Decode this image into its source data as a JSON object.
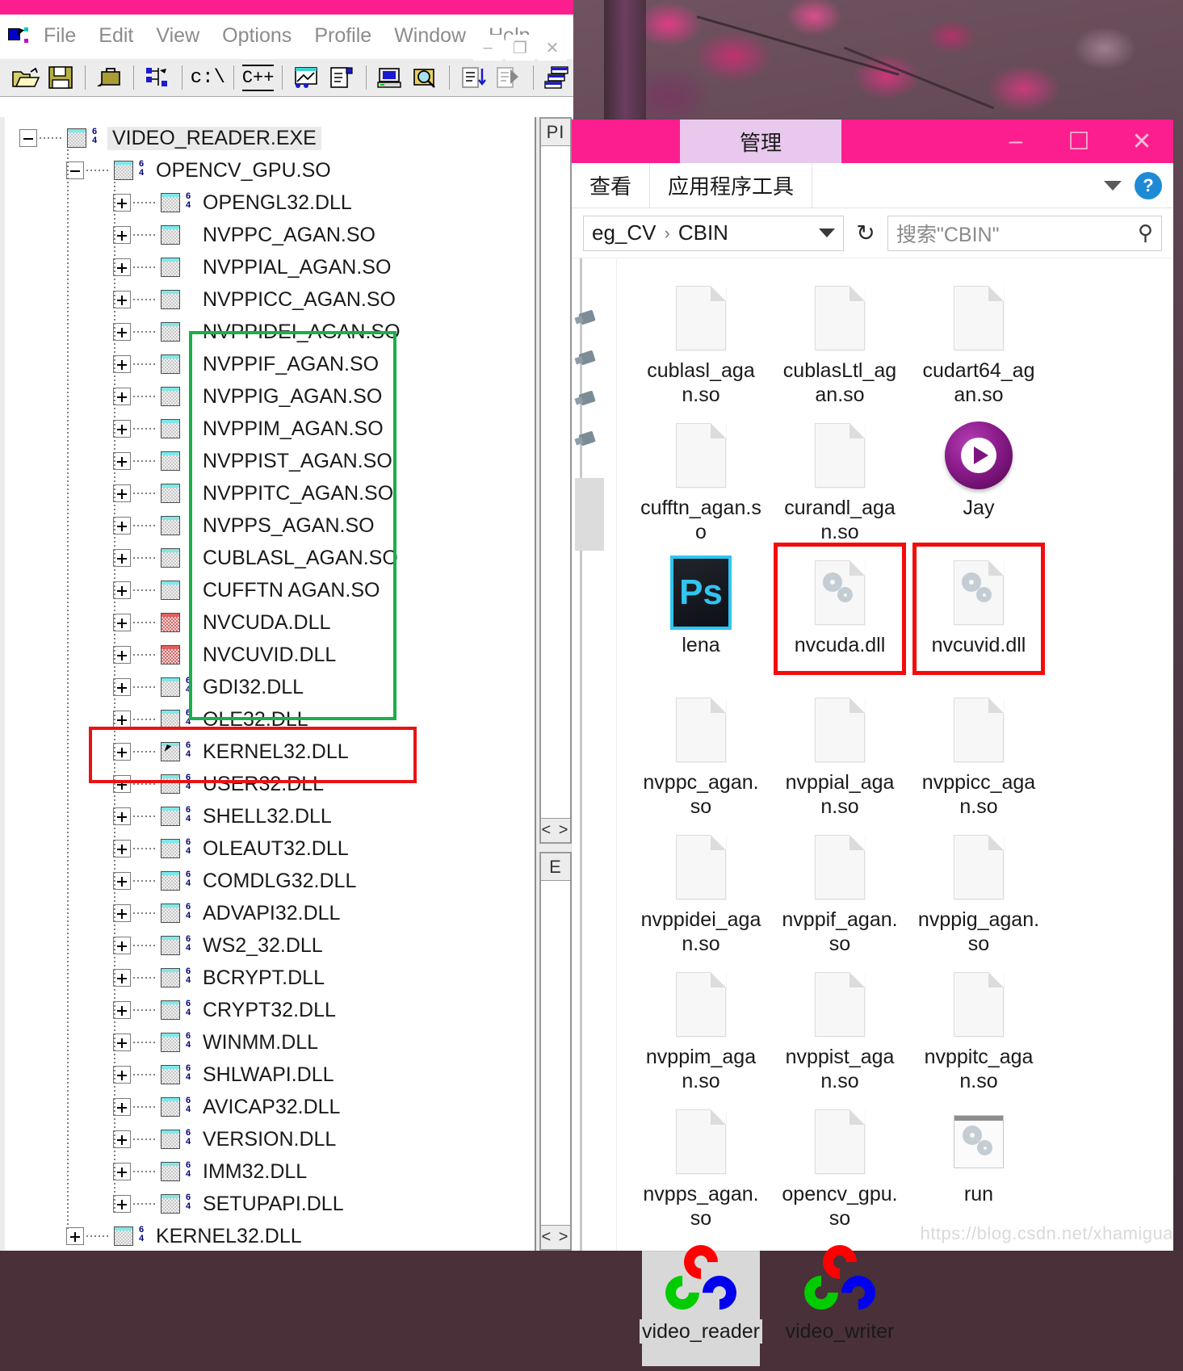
{
  "wallpaper": {
    "description": "cherry-blossom-desktop-wallpaper"
  },
  "depwalker": {
    "menu": [
      "File",
      "Edit",
      "View",
      "Options",
      "Profile",
      "Window",
      "Help"
    ],
    "window_controls": {
      "minimize": "–",
      "restore": "❐",
      "close": "✕"
    },
    "toolbar_icons": [
      "open-folder-icon",
      "save-icon",
      "briefcase-icon",
      "module-tree-icon",
      "command-prompt-icon",
      "cpp-undecorate-icon",
      "expand-all-icon",
      "full-paths-icon",
      "system-info-icon",
      "search-module-icon",
      "sort-icon",
      "clear-log-icon",
      "arrange-windows-icon"
    ],
    "right_pane": {
      "top_header": "PI",
      "bottom_header": "E",
      "scroll_hint": "< >"
    },
    "tree": [
      {
        "label": "VIDEO_READER.EXE",
        "depth": 0,
        "expander": "minus",
        "icon": "module-icon",
        "badge": "64",
        "selected": true
      },
      {
        "label": "OPENCV_GPU.SO",
        "depth": 1,
        "expander": "minus",
        "icon": "module-icon",
        "badge": "64",
        "selected": false
      },
      {
        "label": "OPENGL32.DLL",
        "depth": 2,
        "expander": "plus",
        "icon": "module-icon",
        "badge": "64",
        "selected": false
      },
      {
        "label": "NVPPC_AGAN.SO",
        "depth": 2,
        "expander": "plus",
        "icon": "module-icon",
        "badge": "",
        "selected": false
      },
      {
        "label": "NVPPIAL_AGAN.SO",
        "depth": 2,
        "expander": "plus",
        "icon": "module-icon",
        "badge": "",
        "selected": false
      },
      {
        "label": "NVPPICC_AGAN.SO",
        "depth": 2,
        "expander": "plus",
        "icon": "module-icon",
        "badge": "",
        "selected": false
      },
      {
        "label": "NVPPIDEI_AGAN.SO",
        "depth": 2,
        "expander": "plus",
        "icon": "module-icon",
        "badge": "",
        "selected": false
      },
      {
        "label": "NVPPIF_AGAN.SO",
        "depth": 2,
        "expander": "plus",
        "icon": "module-icon",
        "badge": "",
        "selected": false
      },
      {
        "label": "NVPPIG_AGAN.SO",
        "depth": 2,
        "expander": "plus",
        "icon": "module-icon",
        "badge": "",
        "selected": false
      },
      {
        "label": "NVPPIM_AGAN.SO",
        "depth": 2,
        "expander": "plus",
        "icon": "module-icon",
        "badge": "",
        "selected": false
      },
      {
        "label": "NVPPIST_AGAN.SO",
        "depth": 2,
        "expander": "plus",
        "icon": "module-icon",
        "badge": "",
        "selected": false
      },
      {
        "label": "NVPPITC_AGAN.SO",
        "depth": 2,
        "expander": "plus",
        "icon": "module-icon",
        "badge": "",
        "selected": false
      },
      {
        "label": "NVPPS_AGAN.SO",
        "depth": 2,
        "expander": "plus",
        "icon": "module-icon",
        "badge": "",
        "selected": false
      },
      {
        "label": "CUBLASL_AGAN.SO",
        "depth": 2,
        "expander": "plus",
        "icon": "module-icon",
        "badge": "",
        "selected": false
      },
      {
        "label": "CUFFTN AGAN.SO",
        "depth": 2,
        "expander": "plus",
        "icon": "module-icon",
        "badge": "",
        "selected": false
      },
      {
        "label": "NVCUDA.DLL",
        "depth": 2,
        "expander": "plus",
        "icon": "module-icon-error",
        "badge": "",
        "selected": false
      },
      {
        "label": "NVCUVID.DLL",
        "depth": 2,
        "expander": "plus",
        "icon": "module-icon-error",
        "badge": "",
        "selected": false
      },
      {
        "label": "GDI32.DLL",
        "depth": 2,
        "expander": "plus",
        "icon": "module-icon",
        "badge": "64",
        "selected": false
      },
      {
        "label": "OLE32.DLL",
        "depth": 2,
        "expander": "plus",
        "icon": "module-icon",
        "badge": "64",
        "selected": false
      },
      {
        "label": "KERNEL32.DLL",
        "depth": 2,
        "expander": "plus",
        "icon": "module-icon-cursor",
        "badge": "64",
        "selected": false
      },
      {
        "label": "USER32.DLL",
        "depth": 2,
        "expander": "plus",
        "icon": "module-icon",
        "badge": "64",
        "selected": false
      },
      {
        "label": "SHELL32.DLL",
        "depth": 2,
        "expander": "plus",
        "icon": "module-icon",
        "badge": "64",
        "selected": false
      },
      {
        "label": "OLEAUT32.DLL",
        "depth": 2,
        "expander": "plus",
        "icon": "module-icon",
        "badge": "64",
        "selected": false
      },
      {
        "label": "COMDLG32.DLL",
        "depth": 2,
        "expander": "plus",
        "icon": "module-icon",
        "badge": "64",
        "selected": false
      },
      {
        "label": "ADVAPI32.DLL",
        "depth": 2,
        "expander": "plus",
        "icon": "module-icon",
        "badge": "64",
        "selected": false
      },
      {
        "label": "WS2_32.DLL",
        "depth": 2,
        "expander": "plus",
        "icon": "module-icon",
        "badge": "64",
        "selected": false
      },
      {
        "label": "BCRYPT.DLL",
        "depth": 2,
        "expander": "plus",
        "icon": "module-icon",
        "badge": "64",
        "selected": false
      },
      {
        "label": "CRYPT32.DLL",
        "depth": 2,
        "expander": "plus",
        "icon": "module-icon",
        "badge": "64",
        "selected": false
      },
      {
        "label": "WINMM.DLL",
        "depth": 2,
        "expander": "plus",
        "icon": "module-icon",
        "badge": "64",
        "selected": false
      },
      {
        "label": "SHLWAPI.DLL",
        "depth": 2,
        "expander": "plus",
        "icon": "module-icon",
        "badge": "64",
        "selected": false
      },
      {
        "label": "AVICAP32.DLL",
        "depth": 2,
        "expander": "plus",
        "icon": "module-icon",
        "badge": "64",
        "selected": false
      },
      {
        "label": "VERSION.DLL",
        "depth": 2,
        "expander": "plus",
        "icon": "module-icon",
        "badge": "64",
        "selected": false
      },
      {
        "label": "IMM32.DLL",
        "depth": 2,
        "expander": "plus",
        "icon": "module-icon",
        "badge": "64",
        "selected": false
      },
      {
        "label": "SETUPAPI.DLL",
        "depth": 2,
        "expander": "plus",
        "icon": "module-icon",
        "badge": "64",
        "selected": false
      },
      {
        "label": "KERNEL32.DLL",
        "depth": 1,
        "expander": "plus",
        "icon": "module-icon",
        "badge": "64",
        "selected": false
      }
    ]
  },
  "explorer": {
    "title_tab": "管理",
    "window_controls": {
      "minimize": "–",
      "maximize": "☐",
      "close": "✕"
    },
    "ribbon_tabs": [
      "查看",
      "应用程序工具"
    ],
    "ribbon_help": "?",
    "breadcrumb": [
      "eg_CV",
      "CBIN"
    ],
    "breadcrumb_separator": "›",
    "refresh_icon": "↻",
    "search_placeholder": "搜索\"CBIN\"",
    "search_icon": "search-icon",
    "files": [
      {
        "name": "cublasl_agan.so",
        "icon": "blank-document",
        "selected": false,
        "highlight": ""
      },
      {
        "name": "cublasLtl_agan.so",
        "icon": "blank-document",
        "selected": false,
        "highlight": ""
      },
      {
        "name": "cudart64_agan.so",
        "icon": "blank-document",
        "selected": false,
        "highlight": ""
      },
      {
        "name": "cufftn_agan.so",
        "icon": "blank-document",
        "selected": false,
        "highlight": ""
      },
      {
        "name": "curandl_agan.so",
        "icon": "blank-document",
        "selected": false,
        "highlight": ""
      },
      {
        "name": "Jay",
        "icon": "media-player-icon",
        "selected": false,
        "highlight": ""
      },
      {
        "name": "lena",
        "icon": "photoshop-icon",
        "selected": false,
        "highlight": ""
      },
      {
        "name": "nvcuda.dll",
        "icon": "dll-gears-icon",
        "selected": false,
        "highlight": "red"
      },
      {
        "name": "nvcuvid.dll",
        "icon": "dll-gears-icon",
        "selected": false,
        "highlight": "red"
      },
      {
        "name": "nvppc_agan.so",
        "icon": "blank-document",
        "selected": false,
        "highlight": ""
      },
      {
        "name": "nvppial_agan.so",
        "icon": "blank-document",
        "selected": false,
        "highlight": ""
      },
      {
        "name": "nvppicc_agan.so",
        "icon": "blank-document",
        "selected": false,
        "highlight": ""
      },
      {
        "name": "nvppidei_agan.so",
        "icon": "blank-document",
        "selected": false,
        "highlight": ""
      },
      {
        "name": "nvppif_agan.so",
        "icon": "blank-document",
        "selected": false,
        "highlight": ""
      },
      {
        "name": "nvppig_agan.so",
        "icon": "blank-document",
        "selected": false,
        "highlight": ""
      },
      {
        "name": "nvppim_agan.so",
        "icon": "blank-document",
        "selected": false,
        "highlight": ""
      },
      {
        "name": "nvppist_agan.so",
        "icon": "blank-document",
        "selected": false,
        "highlight": ""
      },
      {
        "name": "nvppitc_agan.so",
        "icon": "blank-document",
        "selected": false,
        "highlight": ""
      },
      {
        "name": "nvpps_agan.so",
        "icon": "blank-document",
        "selected": false,
        "highlight": ""
      },
      {
        "name": "opencv_gpu.so",
        "icon": "blank-document",
        "selected": false,
        "highlight": ""
      },
      {
        "name": "run",
        "icon": "run-window-gears-icon",
        "selected": false,
        "highlight": ""
      },
      {
        "name": "video_reader",
        "icon": "opencv-logo-icon",
        "selected": true,
        "highlight": ""
      },
      {
        "name": "video_writer",
        "icon": "opencv-logo-icon",
        "selected": false,
        "highlight": ""
      }
    ]
  },
  "watermark": "https://blog.csdn.net/xhamigua",
  "colors": {
    "accent_pink": "#fc1e8e",
    "highlight_green": "#18b04a",
    "highlight_red": "#f40c0c",
    "selection_gray": "#d8d8d8"
  }
}
